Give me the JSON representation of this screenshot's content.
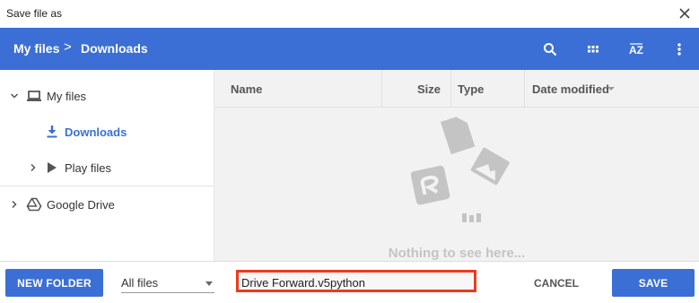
{
  "window": {
    "title": "Save file as"
  },
  "breadcrumb": {
    "root": "My files",
    "separator": ">",
    "current": "Downloads"
  },
  "toolbar": {
    "icons": [
      "search-icon",
      "grid-view-icon",
      "sort-az-icon",
      "more-vert-icon"
    ],
    "sort_label": "AZ"
  },
  "sidebar": {
    "items": [
      {
        "label": "My files",
        "icon": "laptop-icon",
        "expanded": true
      },
      {
        "label": "Downloads",
        "icon": "download-icon",
        "selected": true
      },
      {
        "label": "Play files",
        "icon": "play-files-icon",
        "expanded": false
      },
      {
        "label": "Google Drive",
        "icon": "drive-icon",
        "expanded": false
      }
    ]
  },
  "columns": {
    "name": "Name",
    "size": "Size",
    "type": "Type",
    "date": "Date modified"
  },
  "empty_state": {
    "message": "Nothing to see here..."
  },
  "footer": {
    "new_folder": "NEW FOLDER",
    "filter_value": "All files",
    "filename_value": "Drive Forward.v5python",
    "cancel": "CANCEL",
    "save": "SAVE"
  },
  "colors": {
    "accent": "#3b6fd6",
    "highlight_border": "#ee3a1e",
    "empty_art": "#c4c4c4"
  }
}
